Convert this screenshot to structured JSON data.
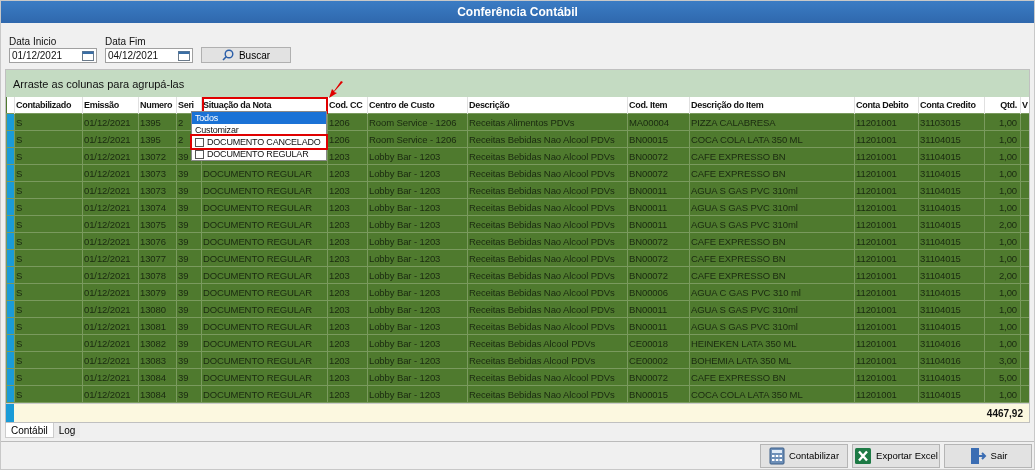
{
  "window": {
    "title": "Conferência Contábil"
  },
  "filters": [
    {
      "label": "Data Inicio",
      "value": "01/12/2021"
    },
    {
      "label": "Data Fim",
      "value": "04/12/2021"
    }
  ],
  "search_button": "Buscar",
  "group_panel": "Arraste as colunas para agrupá-las",
  "table": {
    "columns": [
      "Contabilizado",
      "Emissão",
      "Numero",
      "Seri",
      "Situação da Nota",
      "Cod. CC",
      "Centro de Custo",
      "Descrição",
      "Cod. Item",
      "Descrição do Item",
      "Conta Debito",
      "Conta Credito",
      "Qtd.",
      "V"
    ],
    "rows": [
      {
        "cells": [
          "S",
          "01/12/2021",
          "1395",
          "2",
          null,
          "1206",
          "Room Service - 1206",
          "Receitas Alimentos PDVs",
          "MA00004",
          "PIZZA CALABRESA",
          "11201001",
          "31103015",
          "1,00"
        ]
      },
      {
        "cells": [
          "S",
          "01/12/2021",
          "1395",
          "2",
          null,
          "1206",
          "Room Service - 1206",
          "Receitas Bebidas Nao Alcool PDVs",
          "BN00015",
          "COCA COLA LATA 350 ML",
          "11201001",
          "31104015",
          "1,00"
        ]
      },
      {
        "cells": [
          "S",
          "01/12/2021",
          "13072",
          "39",
          null,
          "1203",
          "Lobby Bar - 1203",
          "Receitas Bebidas Nao Alcool PDVs",
          "BN00072",
          "CAFE EXPRESSO BN",
          "11201001",
          "31104015",
          "1,00"
        ]
      },
      {
        "cells": [
          "S",
          "01/12/2021",
          "13073",
          "39",
          "DOCUMENTO REGULAR",
          "1203",
          "Lobby Bar - 1203",
          "Receitas Bebidas Nao Alcool PDVs",
          "BN00072",
          "CAFE EXPRESSO BN",
          "11201001",
          "31104015",
          "1,00"
        ]
      },
      {
        "cells": [
          "S",
          "01/12/2021",
          "13073",
          "39",
          "DOCUMENTO REGULAR",
          "1203",
          "Lobby Bar - 1203",
          "Receitas Bebidas Nao Alcool PDVs",
          "BN00011",
          "AGUA S GAS PVC 310ml",
          "11201001",
          "31104015",
          "1,00"
        ]
      },
      {
        "cells": [
          "S",
          "01/12/2021",
          "13074",
          "39",
          "DOCUMENTO REGULAR",
          "1203",
          "Lobby Bar - 1203",
          "Receitas Bebidas Nao Alcool PDVs",
          "BN00011",
          "AGUA S GAS PVC 310ml",
          "11201001",
          "31104015",
          "1,00"
        ]
      },
      {
        "cells": [
          "S",
          "01/12/2021",
          "13075",
          "39",
          "DOCUMENTO REGULAR",
          "1203",
          "Lobby Bar - 1203",
          "Receitas Bebidas Nao Alcool PDVs",
          "BN00011",
          "AGUA S GAS PVC 310ml",
          "11201001",
          "31104015",
          "2,00"
        ]
      },
      {
        "cells": [
          "S",
          "01/12/2021",
          "13076",
          "39",
          "DOCUMENTO REGULAR",
          "1203",
          "Lobby Bar - 1203",
          "Receitas Bebidas Nao Alcool PDVs",
          "BN00072",
          "CAFE EXPRESSO BN",
          "11201001",
          "31104015",
          "1,00"
        ]
      },
      {
        "cells": [
          "S",
          "01/12/2021",
          "13077",
          "39",
          "DOCUMENTO REGULAR",
          "1203",
          "Lobby Bar - 1203",
          "Receitas Bebidas Nao Alcool PDVs",
          "BN00072",
          "CAFE EXPRESSO BN",
          "11201001",
          "31104015",
          "1,00"
        ]
      },
      {
        "cells": [
          "S",
          "01/12/2021",
          "13078",
          "39",
          "DOCUMENTO REGULAR",
          "1203",
          "Lobby Bar - 1203",
          "Receitas Bebidas Nao Alcool PDVs",
          "BN00072",
          "CAFE EXPRESSO BN",
          "11201001",
          "31104015",
          "2,00"
        ]
      },
      {
        "cells": [
          "S",
          "01/12/2021",
          "13079",
          "39",
          "DOCUMENTO REGULAR",
          "1203",
          "Lobby Bar - 1203",
          "Receitas Bebidas Nao Alcool PDVs",
          "BN00006",
          "AGUA C GAS PVC 310 ml",
          "11201001",
          "31104015",
          "1,00"
        ]
      },
      {
        "cells": [
          "S",
          "01/12/2021",
          "13080",
          "39",
          "DOCUMENTO REGULAR",
          "1203",
          "Lobby Bar - 1203",
          "Receitas Bebidas Nao Alcool PDVs",
          "BN00011",
          "AGUA S GAS PVC 310ml",
          "11201001",
          "31104015",
          "1,00"
        ]
      },
      {
        "cells": [
          "S",
          "01/12/2021",
          "13081",
          "39",
          "DOCUMENTO REGULAR",
          "1203",
          "Lobby Bar - 1203",
          "Receitas Bebidas Nao Alcool PDVs",
          "BN00011",
          "AGUA S GAS PVC 310ml",
          "11201001",
          "31104015",
          "1,00"
        ]
      },
      {
        "cells": [
          "S",
          "01/12/2021",
          "13082",
          "39",
          "DOCUMENTO REGULAR",
          "1203",
          "Lobby Bar - 1203",
          "Receitas Bebidas Alcool PDVs",
          "CE00018",
          "HEINEKEN LATA 350 ML",
          "11201001",
          "31104016",
          "1,00"
        ]
      },
      {
        "cells": [
          "S",
          "01/12/2021",
          "13083",
          "39",
          "DOCUMENTO REGULAR",
          "1203",
          "Lobby Bar - 1203",
          "Receitas Bebidas Alcool PDVs",
          "CE00002",
          "BOHEMIA LATA 350 ML",
          "11201001",
          "31104016",
          "3,00"
        ]
      },
      {
        "cells": [
          "S",
          "01/12/2021",
          "13084",
          "39",
          "DOCUMENTO REGULAR",
          "1203",
          "Lobby Bar - 1203",
          "Receitas Bebidas Nao Alcool PDVs",
          "BN00072",
          "CAFE EXPRESSO BN",
          "11201001",
          "31104015",
          "5,00"
        ]
      },
      {
        "cells": [
          "S",
          "01/12/2021",
          "13084",
          "39",
          "DOCUMENTO REGULAR",
          "1203",
          "Lobby Bar - 1203",
          "Receitas Bebidas Nao Alcool PDVs",
          "BN00015",
          "COCA COLA LATA 350 ML",
          "11201001",
          "31104015",
          "1,00"
        ]
      }
    ],
    "total": "4467,92"
  },
  "column_filter": {
    "options": [
      {
        "kind": "item",
        "label": "Todos",
        "selected": true
      },
      {
        "kind": "item",
        "label": "Customizar",
        "selected": false
      },
      {
        "kind": "checkbox",
        "label": "DOCUMENTO CANCELADO",
        "checked": false
      },
      {
        "kind": "checkbox",
        "label": "DOCUMENTO REGULAR",
        "checked": false
      }
    ]
  },
  "tabs": [
    {
      "label": "Contábil",
      "selected": true
    },
    {
      "label": "Log",
      "selected": false
    }
  ],
  "buttons": [
    {
      "kind": "calculator",
      "label": "Contabilizar"
    },
    {
      "kind": "excel",
      "label": "Exportar Excel"
    },
    {
      "kind": "exit",
      "label": "Sair"
    }
  ]
}
